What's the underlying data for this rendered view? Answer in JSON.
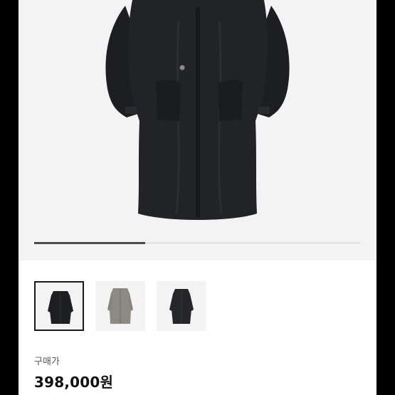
{
  "gallery": {
    "current_fraction": 0.34,
    "thumbnails": [
      {
        "name": "black-coat-front",
        "color": "#1e1f22",
        "selected": true
      },
      {
        "name": "grey-coat-front",
        "color": "#8c8a82",
        "selected": false
      },
      {
        "name": "black-coat-front-alt",
        "color": "#25262a",
        "selected": false
      }
    ]
  },
  "product": {
    "price_label": "구매가",
    "price": "398,000원"
  },
  "colors": {
    "hero_background": "#f3f3f3",
    "coat_black": "#1e1f22",
    "coat_grey": "#8c8a82"
  }
}
